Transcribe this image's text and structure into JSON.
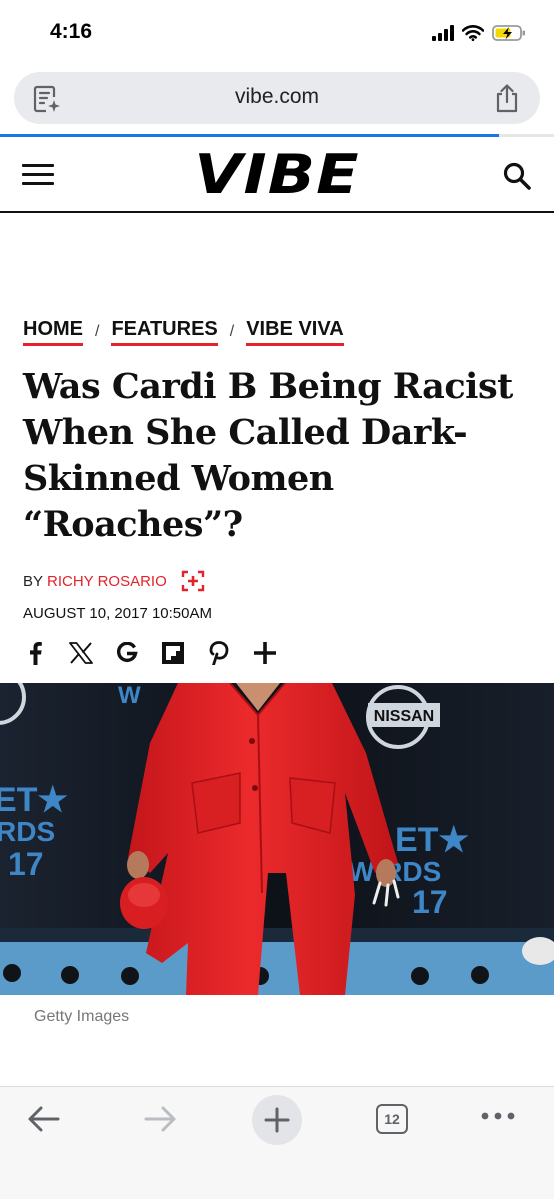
{
  "status": {
    "time": "4:16"
  },
  "browser": {
    "url": "vibe.com",
    "load_progress": 0.9
  },
  "site": {
    "logo": "VIBE"
  },
  "breadcrumbs": [
    "HOME",
    "FEATURES",
    "VIBE VIVA"
  ],
  "article": {
    "headline": "Was Cardi B Being Racist When She Called Dark-Skinned Women “Roaches”?",
    "byline_prefix": "BY",
    "author": "RICHY ROSARIO",
    "date": "AUGUST 10, 2017 10:50AM",
    "share_icons": [
      "facebook-icon",
      "x-icon",
      "google-icon",
      "flipboard-icon",
      "pinterest-icon",
      "plus-icon"
    ],
    "image_credit": "Getty Images",
    "image_backdrop_text": [
      "NISSAN",
      "BET AWARDS 17"
    ]
  },
  "toolbar": {
    "tabs_count": "12"
  },
  "colors": {
    "accent": "#e2232c",
    "progress": "#1a73e8",
    "suit": "#e8282b"
  }
}
